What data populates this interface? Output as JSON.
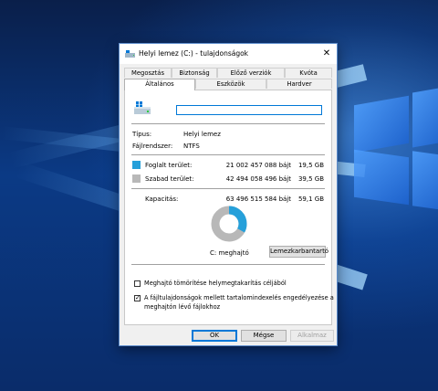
{
  "window": {
    "title": "Helyi lemez (C:) - tulajdonságok",
    "close_glyph": "✕"
  },
  "tabs_row1": [
    "Megosztás",
    "Biztonság",
    "Előző verziók",
    "Kvóta"
  ],
  "tabs_row2": [
    "Általános",
    "Eszközök",
    "Hardver"
  ],
  "active_tab": "Általános",
  "general": {
    "name_value": "",
    "type_label": "Típus:",
    "type_value": "Helyi lemez",
    "fs_label": "Fájlrendszer:",
    "fs_value": "NTFS",
    "used": {
      "label": "Foglalt terület:",
      "bytes": "21 002 457 088 bájt",
      "size": "19,5 GB",
      "color": "#26a0da"
    },
    "free": {
      "label": "Szabad terület:",
      "bytes": "42 494 058 496 bájt",
      "size": "39,5 GB",
      "color": "#b8b8b8"
    },
    "capacity": {
      "label": "Kapacitás:",
      "bytes": "63 496 515 584 bájt",
      "size": "59,1 GB"
    },
    "used_fraction": 0.331,
    "drive_label": "C: meghajtó",
    "cleanup_button": "Lemezkarbantartó",
    "compress_checkbox": {
      "label": "Meghajtó tömörítése helymegtakarítás céljából",
      "checked": false
    },
    "index_checkbox": {
      "label_line1": "A fájltulajdonságok mellett tartalomindexelés engedélyezése a",
      "label_line2": "meghajtón lévő fájlokhoz",
      "checked": true
    }
  },
  "buttons": {
    "ok": "OK",
    "cancel": "Mégse",
    "apply": "Alkalmaz"
  }
}
